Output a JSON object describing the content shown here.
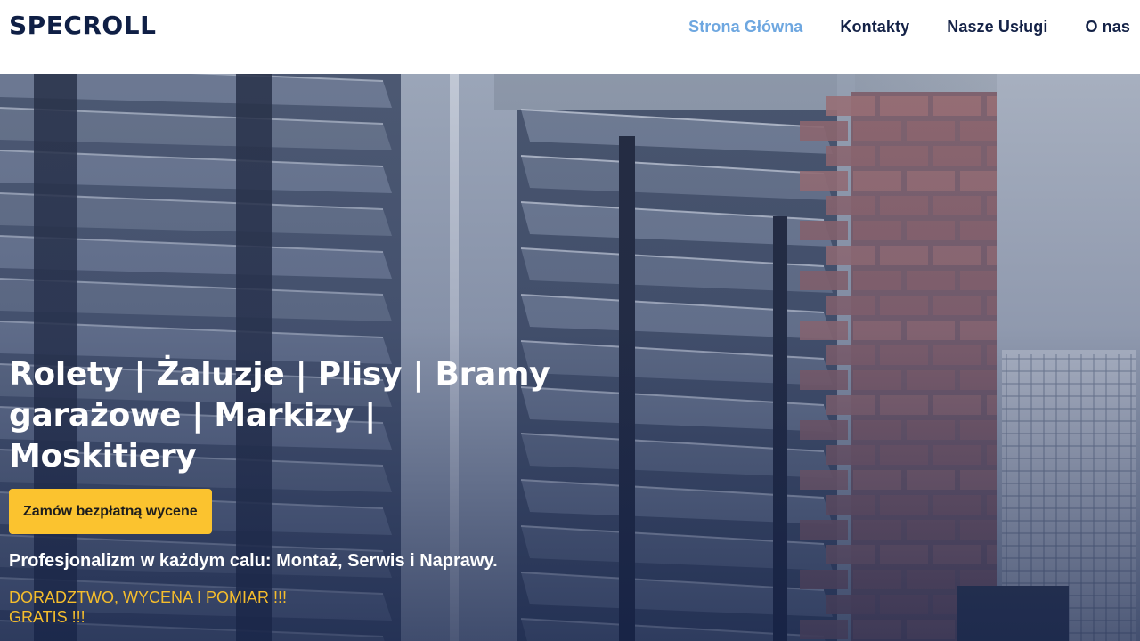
{
  "brand": {
    "logo_text": "SPECROLL"
  },
  "nav": {
    "items": [
      {
        "label": "Strona Główna",
        "active": true
      },
      {
        "label": "Kontakty",
        "active": false
      },
      {
        "label": "Nasze Usługi",
        "active": false
      },
      {
        "label": "O nas",
        "active": false
      }
    ]
  },
  "hero": {
    "title": "Rolety | Żaluzje | Plisy | Bramy garażowe | Markizy | Moskitiery",
    "cta_label": "Zamów bezpłatną wycene",
    "subtitle": "Profesjonalizm w każdym calu: Montaż, Serwis i Naprawy.",
    "offer": "DORADZTWO, WYCENA I POMIAR !!! GRATIS !!!"
  },
  "colors": {
    "brand_navy": "#0f1f45",
    "nav_active": "#6ea7e0",
    "cta_yellow": "#fbc32f",
    "offer_yellow": "#f5bd2c"
  }
}
